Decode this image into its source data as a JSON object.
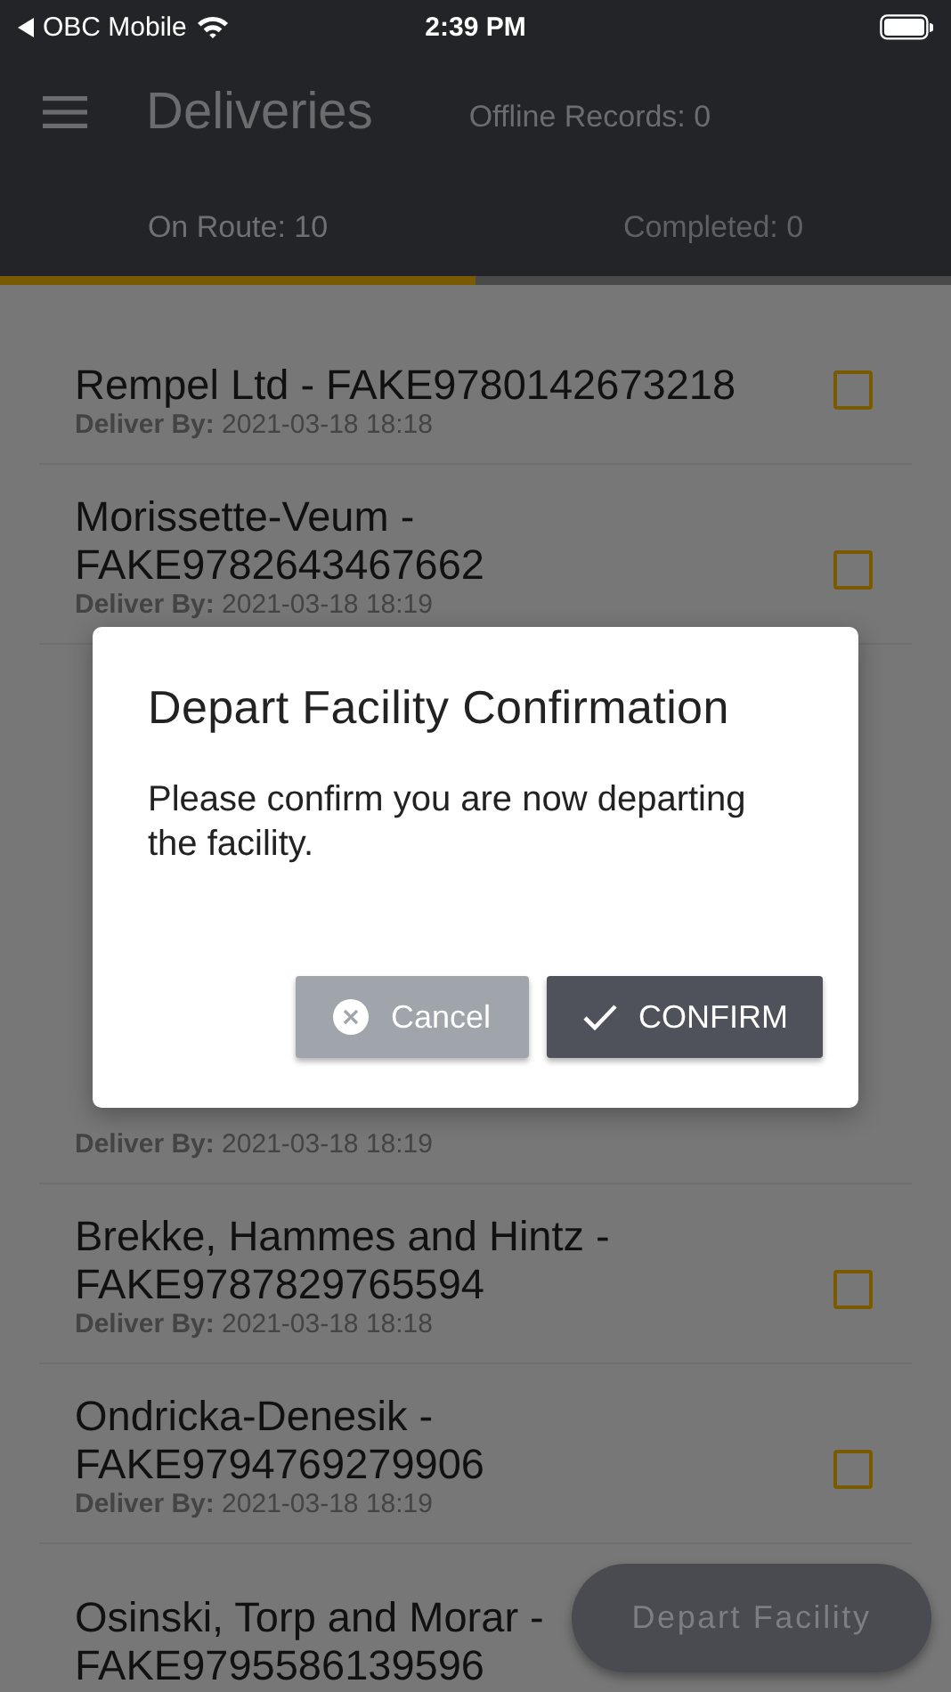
{
  "status_bar": {
    "back_label": "OBC Mobile",
    "time": "2:39 PM"
  },
  "header": {
    "title": "Deliveries",
    "offline": "Offline Records: 0"
  },
  "tabs": [
    {
      "label": "On Route: 10",
      "selected": true
    },
    {
      "label": "Completed: 0",
      "selected": false
    }
  ],
  "deliveries": [
    {
      "title": "Rempel Ltd - FAKE9780142673218",
      "deliver_label": "Deliver By:",
      "deliver_value": "2021-03-18 18:18",
      "checked": false
    },
    {
      "title": "Morissette-Veum - FAKE9782643467662",
      "deliver_label": "Deliver By:",
      "deliver_value": "2021-03-18 18:19",
      "checked": false
    },
    {
      "deliver_label": "Deliver By:",
      "deliver_value": "2021-03-18 18:19"
    },
    {
      "title": "Brekke, Hammes and Hintz - FAKE9787829765594",
      "deliver_label": "Deliver By:",
      "deliver_value": "2021-03-18 18:18",
      "checked": false
    },
    {
      "title": "Ondricka-Denesik - FAKE9794769279906",
      "deliver_label": "Deliver By:",
      "deliver_value": "2021-03-18 18:19",
      "checked": false
    },
    {
      "title": "Osinski, Torp and Morar - FAKE9795586139596"
    }
  ],
  "fab": {
    "label": "Depart Facility"
  },
  "dialog": {
    "title": "Depart Facility Confirmation",
    "message": "Please confirm you are now departing the facility.",
    "buttons": [
      {
        "kind": "cancel",
        "label": "Cancel"
      },
      {
        "kind": "confirm",
        "label": "CONFIRM"
      }
    ]
  }
}
